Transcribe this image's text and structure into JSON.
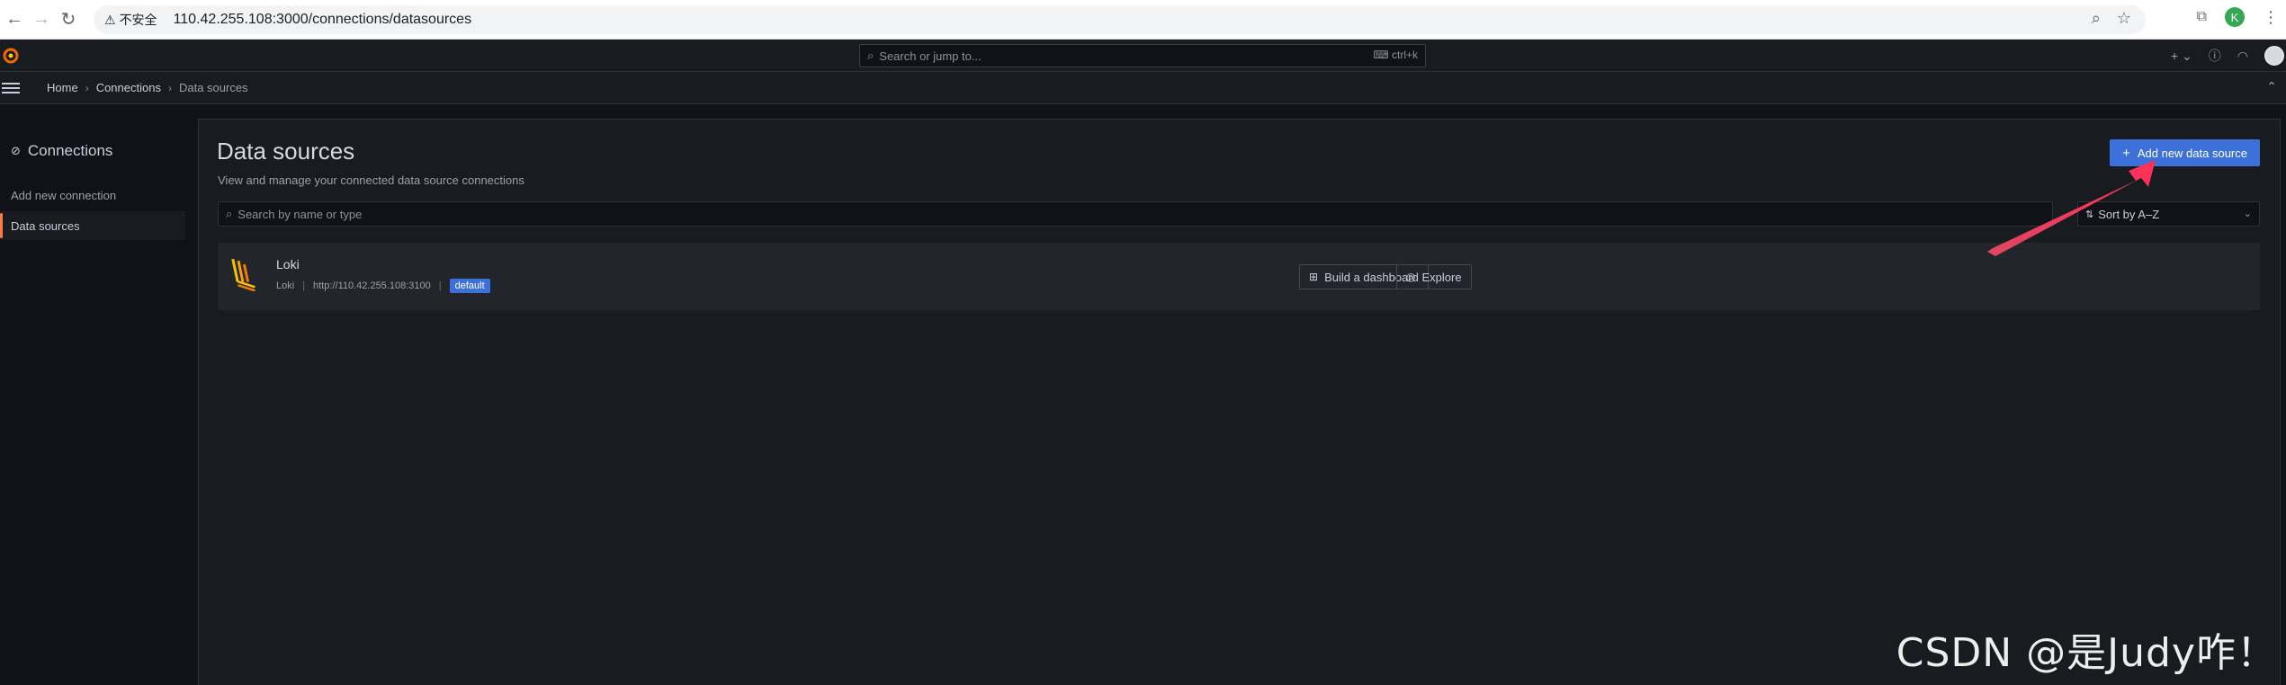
{
  "browser": {
    "security_label": "不安全",
    "url": "110.42.255.108:3000/connections/datasources",
    "profile_initial": "K"
  },
  "topbar": {
    "search_placeholder": "Search or jump to...",
    "search_shortcut": "ctrl+k",
    "add_label": "+"
  },
  "breadcrumb": {
    "items": [
      "Home",
      "Connections",
      "Data sources"
    ]
  },
  "sidebar": {
    "title": "Connections",
    "items": [
      {
        "label": "Add new connection"
      },
      {
        "label": "Data sources"
      }
    ]
  },
  "page": {
    "title": "Data sources",
    "subtitle": "View and manage your connected data source connections",
    "add_button": "Add new data source",
    "search_placeholder": "Search by name or type",
    "sort_label": "Sort by A–Z"
  },
  "datasources": [
    {
      "name": "Loki",
      "type": "Loki",
      "url": "http://110.42.255.108:3100",
      "badge": "default",
      "actions": {
        "build": "Build a dashboard",
        "explore": "Explore"
      }
    }
  ],
  "watermark": "CSDN @是Judy咋！",
  "colors": {
    "accent": "#3d71d9",
    "active_indicator": "#ff7941",
    "annotation_arrow": "#ff4d6a"
  }
}
